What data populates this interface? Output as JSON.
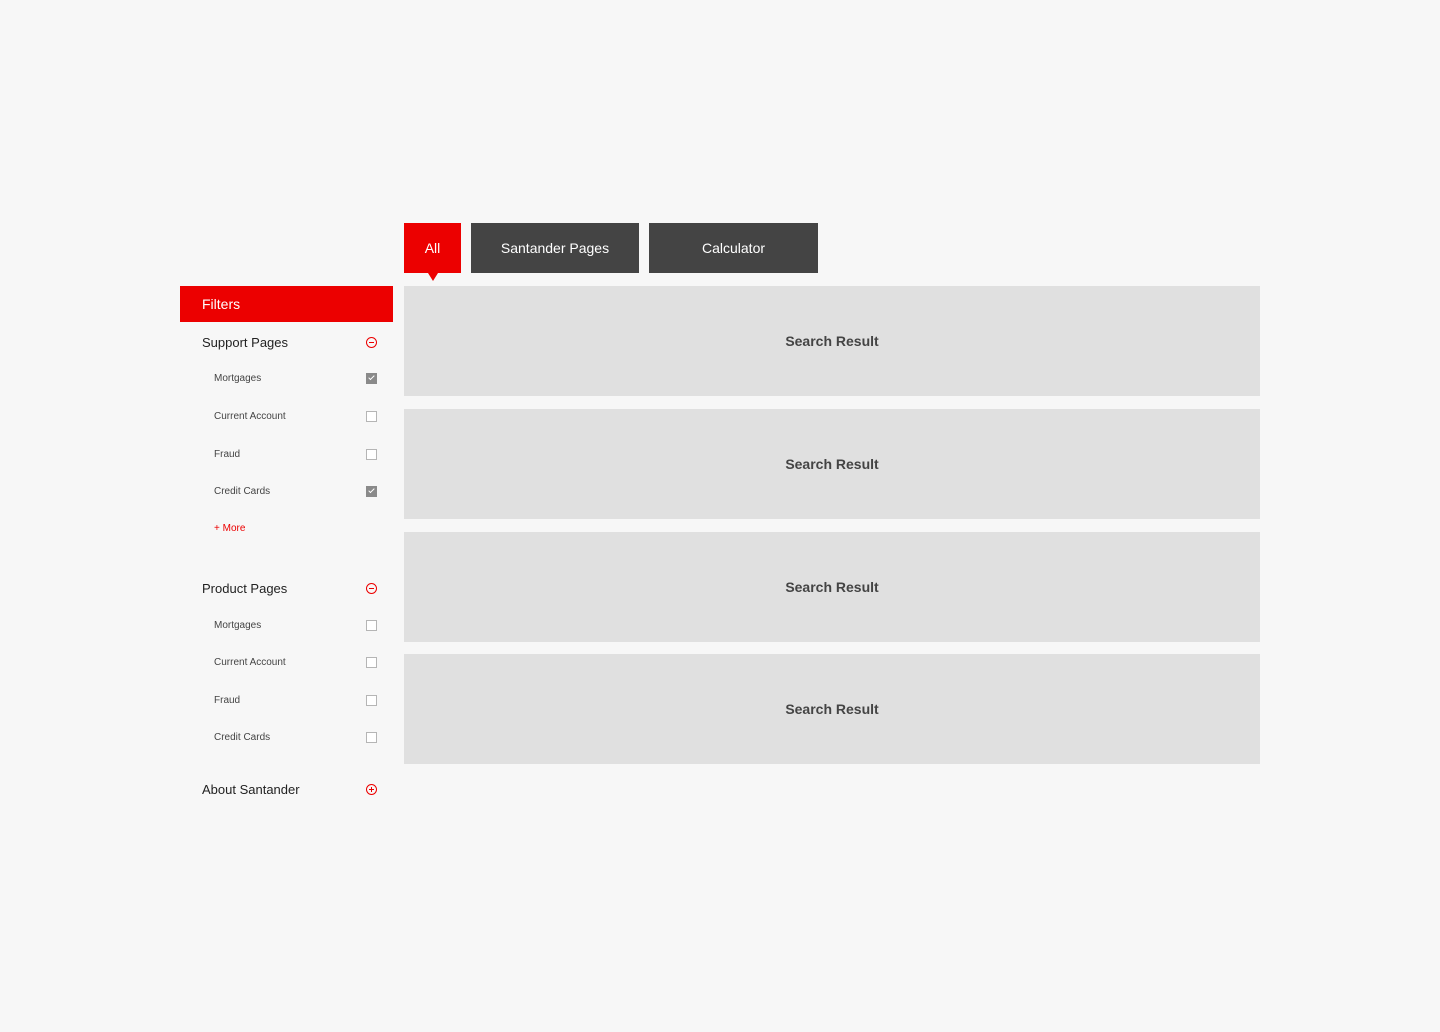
{
  "tabs": {
    "all": "All",
    "santander_pages": "Santander Pages",
    "calculator": "Calculator"
  },
  "sidebar": {
    "header": "Filters",
    "support": {
      "title": "Support Pages",
      "options": [
        {
          "label": "Mortgages",
          "checked": true
        },
        {
          "label": "Current Account",
          "checked": false
        },
        {
          "label": "Fraud",
          "checked": false
        },
        {
          "label": "Credit Cards",
          "checked": true
        }
      ],
      "more": "+ More"
    },
    "product": {
      "title": "Product Pages",
      "options": [
        {
          "label": "Mortgages",
          "checked": false
        },
        {
          "label": "Current Account",
          "checked": false
        },
        {
          "label": "Fraud",
          "checked": false
        },
        {
          "label": "Credit Cards",
          "checked": false
        }
      ]
    },
    "about": {
      "title": "About Santander"
    }
  },
  "results": [
    {
      "label": "Search Result"
    },
    {
      "label": "Search Result"
    },
    {
      "label": "Search Result"
    },
    {
      "label": "Search Result"
    }
  ],
  "colors": {
    "brand_red": "#ec0000",
    "tab_dark": "#444444",
    "card_grey": "#e0e0e0",
    "background": "#f7f7f7"
  }
}
